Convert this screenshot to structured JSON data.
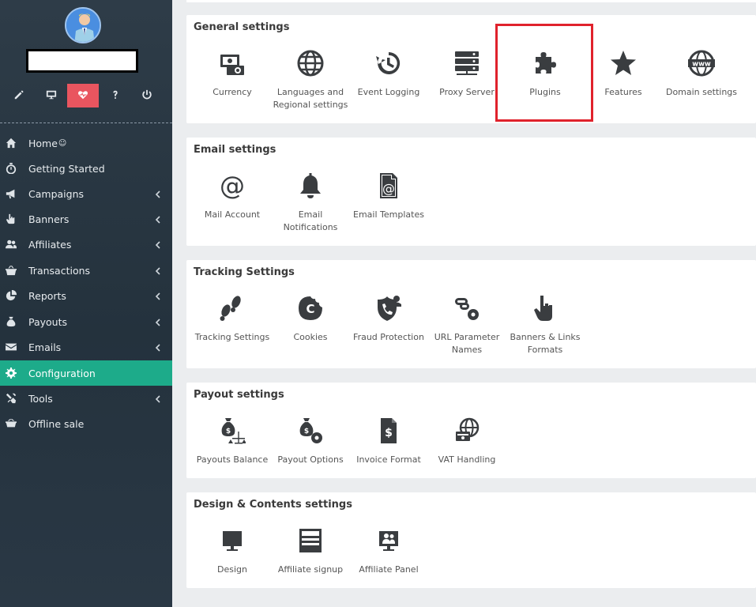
{
  "sidebar": {
    "items": [
      {
        "label": "Home",
        "icon": "home-icon",
        "has_submenu": false
      },
      {
        "label": "Getting Started",
        "icon": "stopwatch-icon",
        "has_submenu": false
      },
      {
        "label": "Campaigns",
        "icon": "megaphone-icon",
        "has_submenu": true
      },
      {
        "label": "Banners",
        "icon": "pointer-hand-icon",
        "has_submenu": true
      },
      {
        "label": "Affiliates",
        "icon": "users-icon",
        "has_submenu": true
      },
      {
        "label": "Transactions",
        "icon": "basket-icon",
        "has_submenu": true
      },
      {
        "label": "Reports",
        "icon": "pie-chart-icon",
        "has_submenu": true
      },
      {
        "label": "Payouts",
        "icon": "money-bag-icon",
        "has_submenu": true
      },
      {
        "label": "Emails",
        "icon": "envelope-icon",
        "has_submenu": true
      },
      {
        "label": "Configuration",
        "icon": "gear-icon",
        "has_submenu": false,
        "active": true
      },
      {
        "label": "Tools",
        "icon": "tools-icon",
        "has_submenu": true
      },
      {
        "label": "Offline sale",
        "icon": "cart-icon",
        "has_submenu": false
      }
    ],
    "quick_actions": [
      "edit-icon",
      "monitor-icon",
      "heartbeat-icon",
      "help-icon",
      "power-icon"
    ]
  },
  "sections": [
    {
      "title": "General settings",
      "tiles": [
        "Currency",
        "Languages and Regional settings",
        "Event Logging",
        "Proxy Server",
        "Plugins",
        "Features",
        "Domain settings"
      ]
    },
    {
      "title": "Email settings",
      "tiles": [
        "Mail Account",
        "Email Notifications",
        "Email Templates"
      ]
    },
    {
      "title": "Tracking Settings",
      "tiles": [
        "Tracking Settings",
        "Cookies",
        "Fraud Protection",
        "URL Parameter Names",
        "Banners & Links Formats"
      ]
    },
    {
      "title": "Payout settings",
      "tiles": [
        "Payouts Balance",
        "Payout Options",
        "Invoice Format",
        "VAT Handling"
      ]
    },
    {
      "title": "Design & Contents settings",
      "tiles": [
        "Design",
        "Affiliate signup",
        "Affiliate Panel"
      ]
    }
  ],
  "colors": {
    "active_nav": "#1dab8a",
    "heart_button": "#e9555f",
    "highlight": "#e0222c"
  }
}
